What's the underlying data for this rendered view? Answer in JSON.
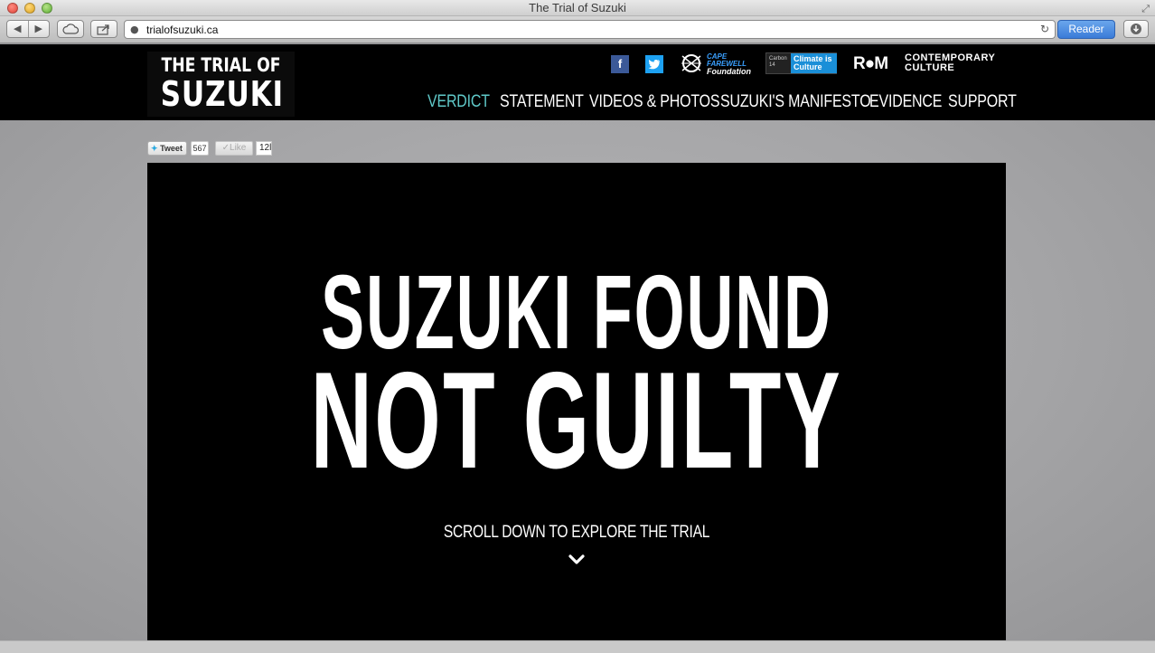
{
  "window": {
    "title": "The Trial of Suzuki"
  },
  "toolbar": {
    "url": "trialofsuzuki.ca",
    "reader_label": "Reader"
  },
  "site": {
    "logo_line1": "THE TRIAL OF",
    "logo_line2": "SUZUKI",
    "partners": {
      "cape_farewell_line1": "CAPE FAREWELL",
      "cape_farewell_line2": "Foundation",
      "carbon14_label": "Carbon 14",
      "carbon14_box": "Climate is Culture",
      "rom_mark": "R●M",
      "rom_text_line1": "CONTEMPORARY",
      "rom_text_line2": "CULTURE"
    },
    "nav": [
      {
        "label": "VERDICT",
        "active": true
      },
      {
        "label": "STATEMENT",
        "active": false
      },
      {
        "label": "VIDEOS & PHOTOS",
        "active": false
      },
      {
        "label": "SUZUKI'S MANIFESTO",
        "active": false
      },
      {
        "label": "EVIDENCE",
        "active": false
      },
      {
        "label": "SUPPORT",
        "active": false
      }
    ]
  },
  "share": {
    "tweet_label": "Tweet",
    "tweet_count": "567",
    "like_label": "Like",
    "like_count": "12l"
  },
  "hero": {
    "line1": "SUZUKI FOUND",
    "line2": "NOT GUILTY",
    "scroll_text": "SCROLL DOWN TO EXPLORE THE TRIAL"
  },
  "colors": {
    "nav_active": "#5fc8c8",
    "header_bg": "#000000",
    "page_bg": "#a5a5a7",
    "reader_blue": "#3a7bd8"
  }
}
